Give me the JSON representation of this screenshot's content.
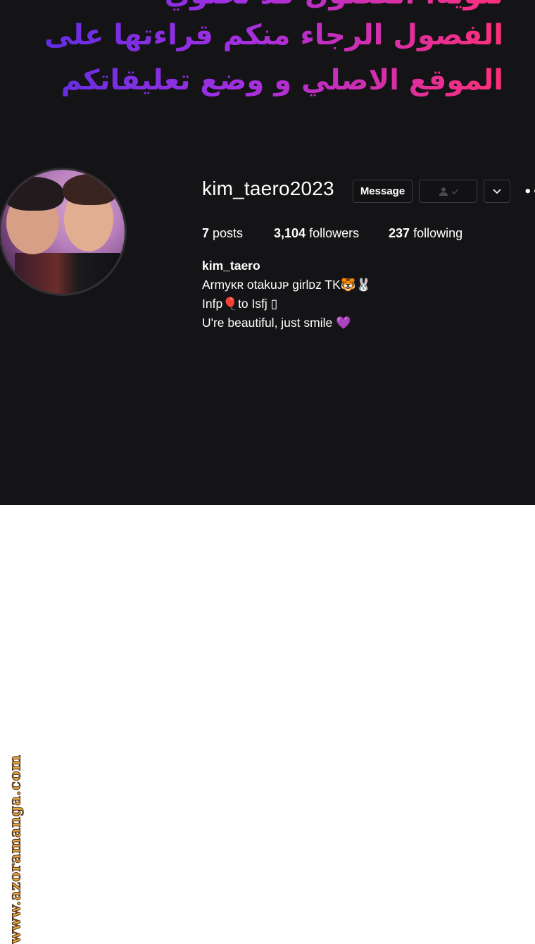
{
  "banner": {
    "line0": "تنويه: الفصول قد تحتوي",
    "line1": "الفصول الرجاء منكم قراءتها على",
    "line2": "الموقع الاصلي و وضع تعليقاتكم"
  },
  "profile": {
    "username": "kim_taero2023",
    "message_label": "Message",
    "stats": {
      "posts_count": "7",
      "posts_label": "posts",
      "followers_count": "3,104",
      "followers_label": "followers",
      "following_count": "237",
      "following_label": "following"
    },
    "bio": {
      "name": "kim_taero",
      "line1": "Armyᴋʀ otakuᴊᴘ girlᴅᴢ TK🐯🐰",
      "line2": "Infp🎈to Isfj ▯",
      "line3": "U're beautiful, just smile 💜"
    }
  },
  "watermark": "www.azoramanga.com",
  "icons": {
    "follow": "person-icon",
    "dropdown": "chevron-down-icon",
    "more": "more-options-icon"
  },
  "colors": {
    "dark_background": "#141315",
    "banner_gradient_start": "#5a2de0",
    "banner_gradient_end": "#ff2f78",
    "watermark": "#e7a640"
  }
}
